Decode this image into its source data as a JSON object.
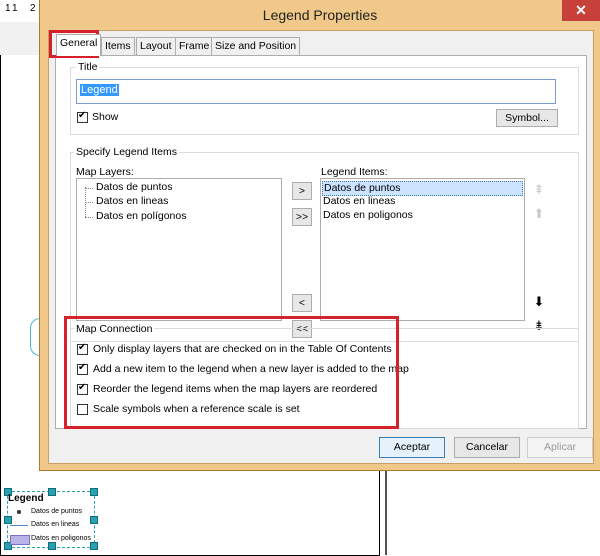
{
  "background": {
    "ruler_marks": [
      "1",
      "1",
      "2"
    ],
    "legend": {
      "title": "Legend",
      "items": [
        "Datos de puntos",
        "Datos en lineas",
        "Datos en poligonos"
      ]
    }
  },
  "dialog": {
    "title": "Legend Properties",
    "close_label": "✕",
    "tabs": [
      {
        "label": "General",
        "active": true
      },
      {
        "label": "Items"
      },
      {
        "label": "Layout"
      },
      {
        "label": "Frame"
      },
      {
        "label": "Size and Position"
      }
    ],
    "title_group": {
      "label": "Title",
      "value": "Legend",
      "show_label": "Show",
      "show_checked": true,
      "symbol_button": "Symbol..."
    },
    "specify_group": {
      "label": "Specify Legend Items",
      "map_layers_label": "Map Layers:",
      "map_layers": [
        "Datos de puntos",
        "Datos en lineas",
        "Datos en polígonos"
      ],
      "legend_items_label": "Legend Items:",
      "legend_items": [
        "Datos de puntos",
        "Datos en lineas",
        "Datos en poligonos"
      ],
      "add_one": ">",
      "add_all": ">>",
      "remove_one": "<",
      "remove_all": "<<"
    },
    "map_connection": {
      "label": "Map Connection",
      "options": [
        {
          "label": "Only display layers that are checked on in the Table Of Contents",
          "checked": true
        },
        {
          "label": "Add a new item to the legend when a new layer is added to the map",
          "checked": true
        },
        {
          "label": "Reorder the legend items when the map layers are reordered",
          "checked": true
        },
        {
          "label": "Scale symbols when a reference scale is set",
          "checked": false
        }
      ]
    },
    "buttons": {
      "ok": "Aceptar",
      "cancel": "Cancelar",
      "apply": "Aplicar"
    }
  },
  "colors": {
    "highlight": "#d6202c",
    "dialog_frame": "#f0c98a",
    "selection": "#3399ff"
  }
}
